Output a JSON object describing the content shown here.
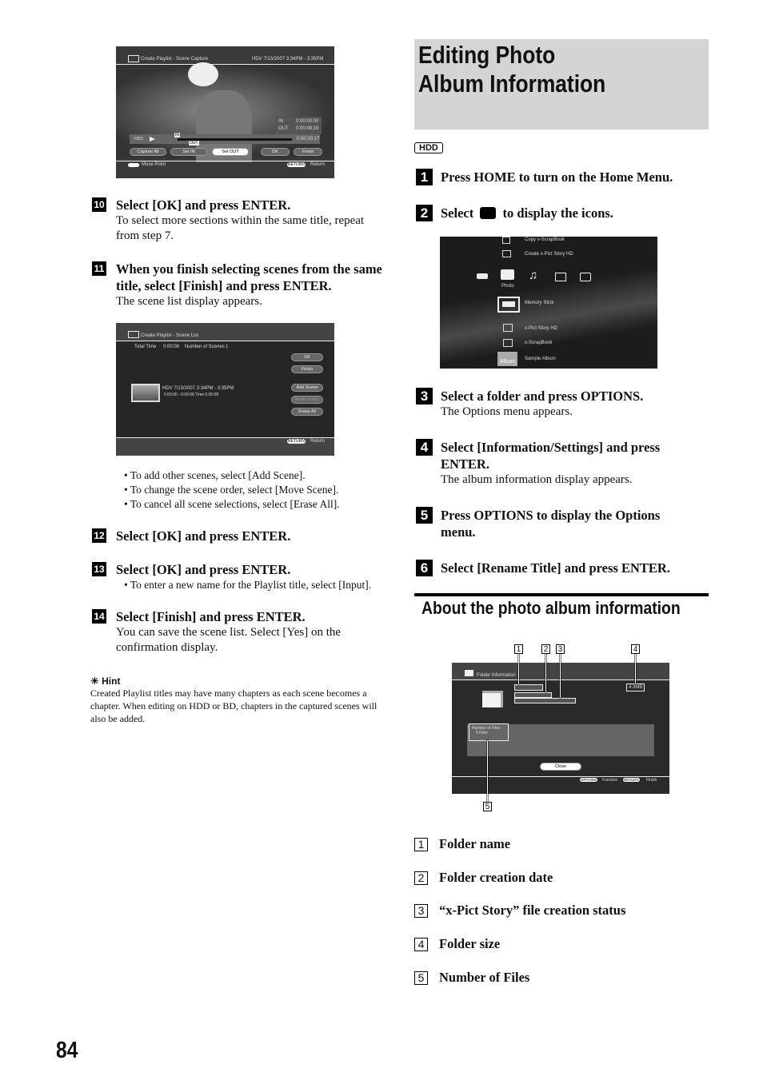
{
  "left": {
    "scene_capture": {
      "title": "Create Playlist - Scene Capture",
      "info": "HDV  7/13/2007  3:34PM - 3:35PM",
      "in_label": "IN",
      "in_time": "0:00:00:00",
      "out_label": "OUT",
      "out_time": "0:00:08:19",
      "source": "HDD",
      "marker_in": "IN",
      "marker_out": "OUT",
      "elapsed": "0:00:10:17",
      "buttons": [
        "Capture All",
        "Set IN",
        "Set OUT",
        "OK",
        "Finish"
      ],
      "footer_left": "Move Point",
      "footer_right_key": "RETURN",
      "footer_right": "Return"
    },
    "steps_a": [
      {
        "num": "10",
        "title": "Select [OK] and press ENTER.",
        "body": "To select more sections within the same title, repeat from step 7."
      },
      {
        "num": "11",
        "title": "When you finish selecting scenes from the same title, select [Finish] and press ENTER.",
        "body": "The scene list display appears."
      }
    ],
    "scene_list": {
      "title": "Create Playlist - Scene List",
      "total_time_label": "Total Time",
      "total_time": "0:00:08",
      "scenes_label": "Number of Scenes",
      "scenes": "1",
      "item_line1": "HDV  7/13/2007  3:34PM - 3:35PM",
      "item_line2": "0:00:00 - 0:00:08   Time  0:00:08",
      "buttons": [
        "OK",
        "Finish",
        "Add Scene",
        "Move Scene",
        "Erase All"
      ],
      "footer_key": "RETURN",
      "footer": "Return"
    },
    "bullets": [
      "• To add other scenes, select [Add Scene].",
      "• To change the scene order, select [Move Scene].",
      "• To cancel all scene selections, select [Erase All]."
    ],
    "step12": {
      "num": "12",
      "title": "Select [OK] and press ENTER."
    },
    "step13": {
      "num": "13",
      "title": "Select [OK] and press ENTER.",
      "bullet": "• To enter a new name for the Playlist title, select [Input]."
    },
    "step14": {
      "num": "14",
      "title": "Select [Finish] and press ENTER.",
      "body": "You can save the scene list. Select [Yes] on the confirmation display."
    },
    "hint": {
      "label": "Hint",
      "text": "Created Playlist titles may have many chapters as each scene becomes a chapter. When editing on HDD or BD, chapters in the captured scenes will also be added."
    }
  },
  "right": {
    "heading": "Editing Photo Album Information",
    "badge": "HDD",
    "steps": [
      {
        "num": "1",
        "title": "Press HOME to turn on the Home Menu."
      },
      {
        "num": "2",
        "title_a": "Select",
        "title_b": "to display the icons."
      },
      {
        "num": "3",
        "title": "Select a folder and press OPTIONS.",
        "body": "The Options menu appears."
      },
      {
        "num": "4",
        "title": "Select [Information/Settings] and press ENTER.",
        "body": "The album information display appears."
      },
      {
        "num": "5",
        "title": "Press OPTIONS to display the Options menu."
      },
      {
        "num": "6",
        "title": "Select [Rename Title] and press ENTER."
      }
    ],
    "home_menu": {
      "items_top": [
        "Copy x-ScrapBook",
        "Create x-Pict Story HD"
      ],
      "category": "Photo",
      "items_bottom": [
        "Memory Stick",
        "x-Pict Story HD",
        "x-ScrapBook",
        "Sample Album"
      ],
      "album_thumb": "Album"
    },
    "subheading": "About the photo album information",
    "folder_info": {
      "title": "Folder Information",
      "size": "4.3MB",
      "files_label": "Number of Files",
      "files": "5 Files",
      "close": "Close",
      "footer_options_key": "OPTIONS",
      "footer_options": "Function",
      "footer_return_key": "RETURN",
      "footer_return": "Finish",
      "callouts": [
        "1",
        "2",
        "3",
        "4",
        "5"
      ]
    },
    "legend": [
      {
        "num": "1",
        "label": "Folder name"
      },
      {
        "num": "2",
        "label": "Folder creation date"
      },
      {
        "num": "3",
        "label": "“x-Pict Story” file creation status"
      },
      {
        "num": "4",
        "label": "Folder size"
      },
      {
        "num": "5",
        "label": "Number of Files"
      }
    ]
  },
  "page_number": "84"
}
